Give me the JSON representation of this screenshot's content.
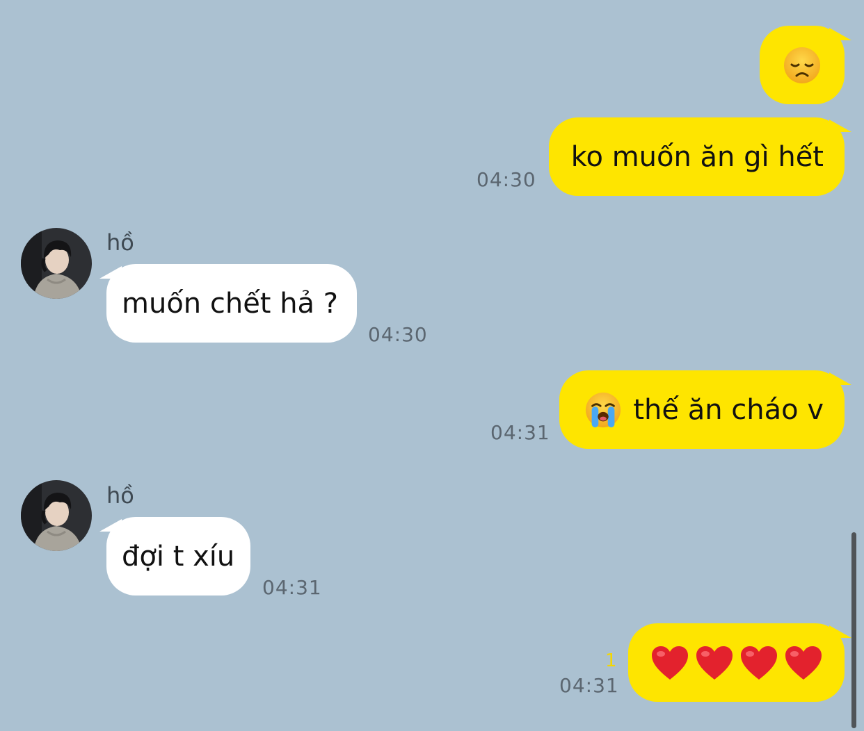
{
  "colors": {
    "background": "#abc1d1",
    "my_bubble": "#fee500",
    "their_bubble": "#ffffff",
    "timestamp": "#5b6670",
    "unread": "#f4d700"
  },
  "messages": [
    {
      "from": "me",
      "emojis": [
        "disappointed-face"
      ],
      "text": "",
      "time": ""
    },
    {
      "from": "me",
      "emojis": [],
      "text": "ko muốn ăn gì hết",
      "time": "04:30"
    },
    {
      "from": "hồ",
      "sender": "hồ",
      "avatar": "avatar-photo",
      "text": "muốn chết hả ?",
      "time": "04:30"
    },
    {
      "from": "me",
      "emojis": [
        "loudly-crying-face"
      ],
      "text": "thế ăn cháo v",
      "time": "04:31"
    },
    {
      "from": "hồ",
      "sender": "hồ",
      "avatar": "avatar-photo",
      "text": "đợi t xíu",
      "time": "04:31"
    },
    {
      "from": "me",
      "emojis": [
        "red-heart",
        "red-heart",
        "red-heart",
        "red-heart"
      ],
      "text": "",
      "unread": "1",
      "time": "04:31"
    }
  ]
}
